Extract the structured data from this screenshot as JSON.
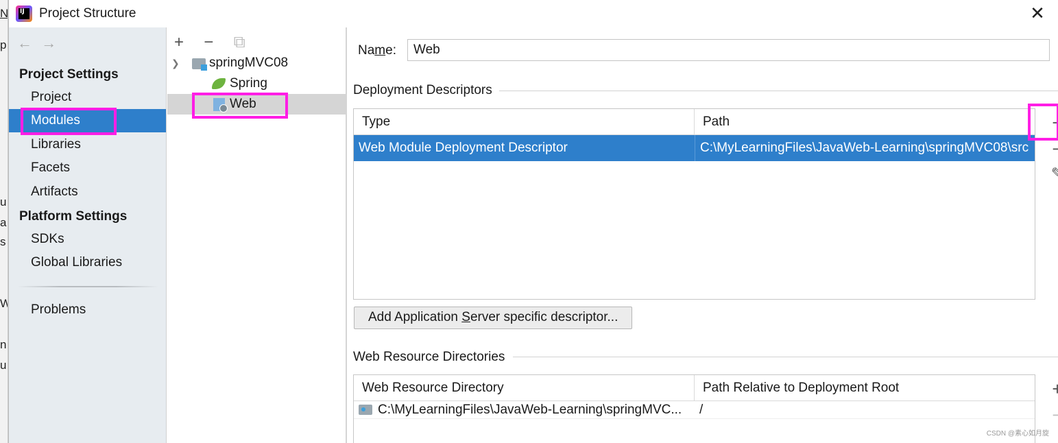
{
  "background": {
    "fragments": [
      "N",
      "p",
      "u",
      "a",
      "s",
      "W",
      "n",
      "u"
    ]
  },
  "window": {
    "title": "Project Structure",
    "close_glyph": "✕"
  },
  "nav": {
    "back_glyph": "←",
    "forward_glyph": "→",
    "project_settings_heading": "Project Settings",
    "platform_settings_heading": "Platform Settings",
    "items": {
      "project": "Project",
      "modules": "Modules",
      "libraries": "Libraries",
      "facets": "Facets",
      "artifacts": "Artifacts",
      "sdks": "SDKs",
      "global_libraries": "Global Libraries",
      "problems": "Problems"
    },
    "selected": "Modules"
  },
  "tree": {
    "toolbar": {
      "add": "+",
      "remove": "−",
      "copy": "⧉"
    },
    "root": "springMVC08",
    "children": [
      "Spring",
      "Web"
    ],
    "selected": "Web"
  },
  "detail": {
    "name_label_pre": "Na",
    "name_label_mnemonic": "m",
    "name_label_post": "e:",
    "name_value": "Web",
    "deployment_descriptors": {
      "title": "Deployment Descriptors",
      "columns": [
        "Type",
        "Path"
      ],
      "rows": [
        {
          "type": "Web Module Deployment Descriptor",
          "path": "C:\\MyLearningFiles\\JavaWeb-Learning\\springMVC08\\src"
        }
      ],
      "tools": {
        "add": "+",
        "remove": "−",
        "edit": "✎"
      }
    },
    "add_server_button_pre": "Add Application ",
    "add_server_button_mnemonic": "S",
    "add_server_button_post": "erver specific descriptor...",
    "web_resource_directories": {
      "title": "Web Resource Directories",
      "columns": [
        "Web Resource Directory",
        "Path Relative to Deployment Root"
      ],
      "rows": [
        {
          "directory": "C:\\MyLearningFiles\\JavaWeb-Learning\\springMVC...",
          "relative_path": "/"
        }
      ],
      "tools": {
        "add": "+",
        "remove": "−"
      }
    }
  },
  "watermark": "CSDN @素心如月旋",
  "colors": {
    "selection": "#2e7fcb",
    "highlight": "#ff1ee5",
    "nav_bg": "#e7ecf0"
  }
}
